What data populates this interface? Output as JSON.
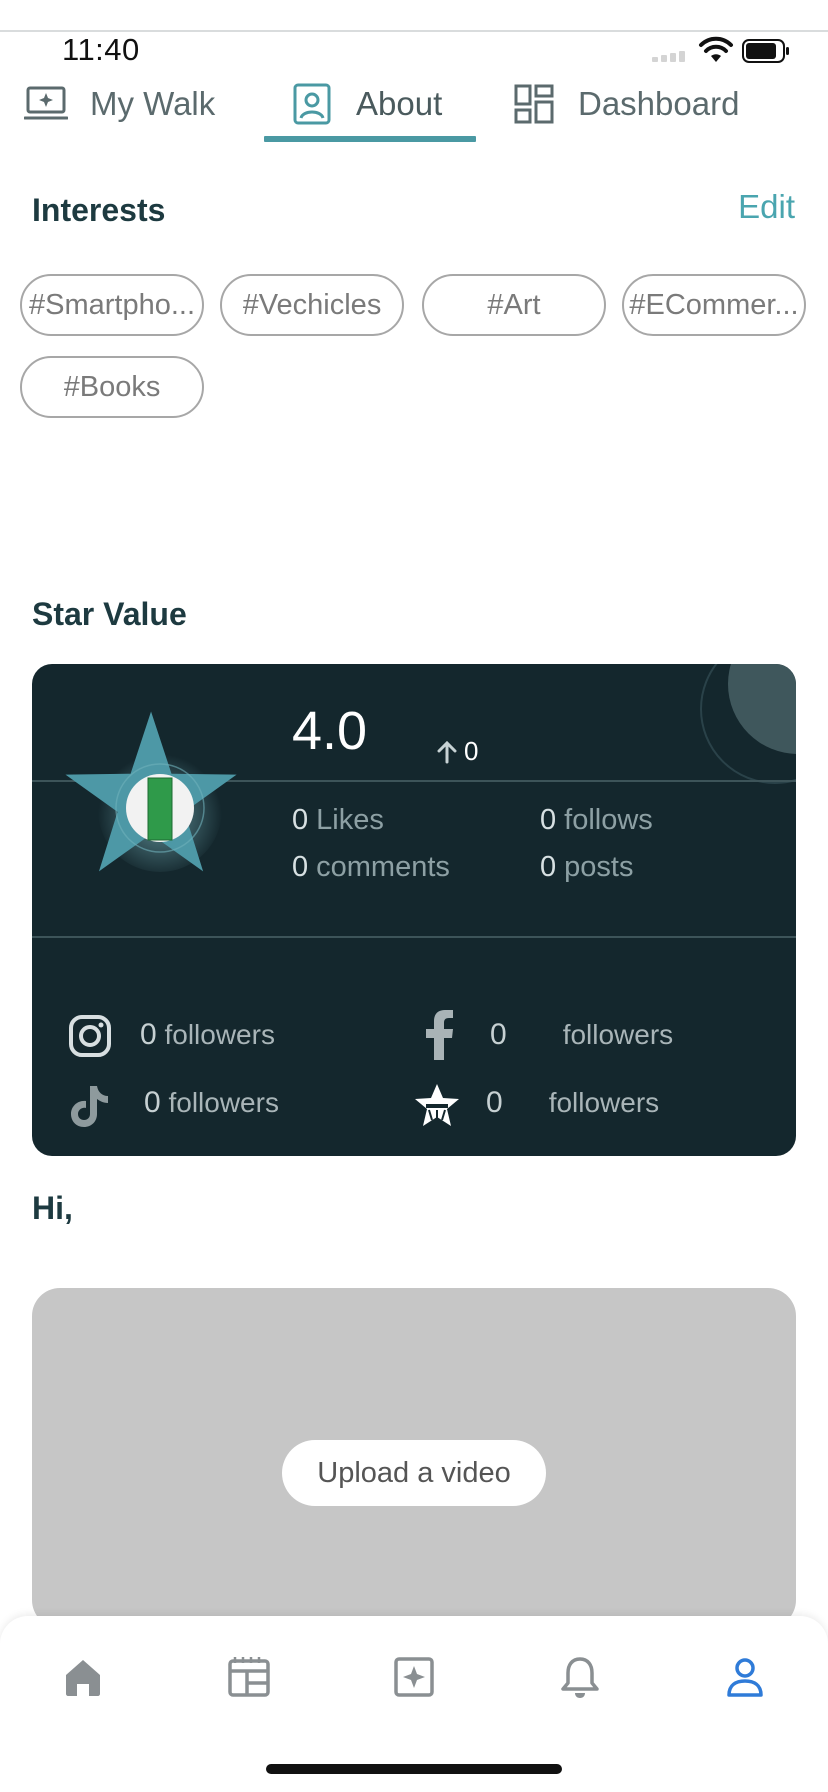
{
  "status": {
    "time": "11:40"
  },
  "tabs": [
    {
      "label": "My Walk",
      "icon": "laptop-star-icon",
      "active": false
    },
    {
      "label": "About",
      "icon": "contact-card-icon",
      "active": true
    },
    {
      "label": "Dashboard",
      "icon": "dashboard-icon",
      "active": false
    }
  ],
  "interests": {
    "title": "Interests",
    "edit_label": "Edit",
    "chips": [
      "#Smartpho...",
      "#Vechicles",
      "#Art",
      "#ECommer...",
      "#Books"
    ]
  },
  "star_value": {
    "title": "Star Value",
    "value": "4.0",
    "delta": "0",
    "stats": {
      "likes_count": "0",
      "likes_label": "Likes",
      "follows_count": "0",
      "follows_label": "follows",
      "comments_count": "0",
      "comments_label": "comments",
      "posts_count": "0",
      "posts_label": "posts"
    },
    "social": [
      {
        "platform": "instagram",
        "count": "0",
        "label": "followers"
      },
      {
        "platform": "facebook",
        "count": "0",
        "label": "followers"
      },
      {
        "platform": "tiktok",
        "count": "0",
        "label": "followers"
      },
      {
        "platform": "app-star",
        "count": "0",
        "label": "followers"
      }
    ]
  },
  "greeting": "Hi,",
  "video": {
    "upload_label": "Upload a video"
  },
  "colors": {
    "accent": "#4a99a3",
    "card_bg": "#14272d",
    "active_nav": "#2f7bd8"
  },
  "bottom_nav": [
    {
      "icon": "home-icon",
      "active": false
    },
    {
      "icon": "feed-icon",
      "active": false
    },
    {
      "icon": "sparkle-square-icon",
      "active": false
    },
    {
      "icon": "bell-icon",
      "active": false
    },
    {
      "icon": "profile-icon",
      "active": true
    }
  ]
}
